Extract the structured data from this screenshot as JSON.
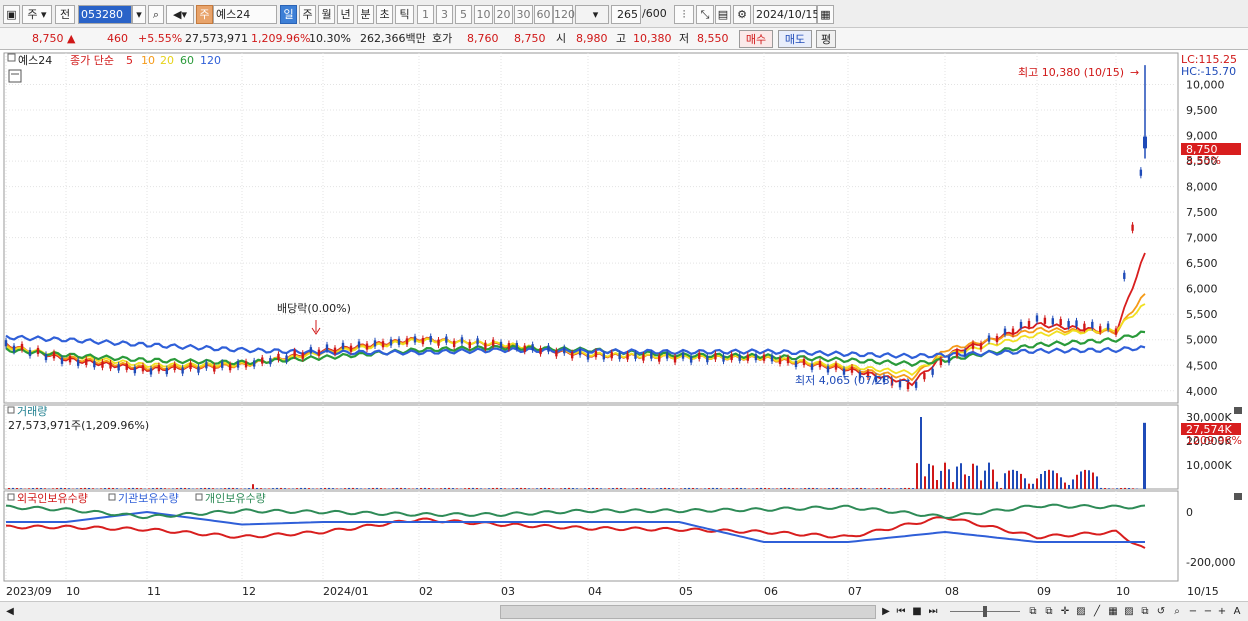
{
  "toolbar": {
    "market": "주",
    "prev_label": "전",
    "code": "053280",
    "stock_tag": "주",
    "stock_name": "예스24",
    "periods": [
      "일",
      "주",
      "월",
      "년",
      "분",
      "초",
      "틱"
    ],
    "selected_period": "일",
    "intervals": [
      "1",
      "3",
      "5",
      "10",
      "20",
      "30",
      "60",
      "120"
    ],
    "count": "265",
    "count_max": "/600",
    "date": "2024/10/15"
  },
  "info": {
    "price": "8,750",
    "change": "460",
    "change_pct": "+5.55%",
    "volume": "27,573,971",
    "volume_ratio": "1,209.96%",
    "turnover": "10.30%",
    "amount": "262,366백만",
    "quote_label": "호가",
    "ask": "8,760",
    "bid": "8,750",
    "open_label": "시",
    "open": "8,980",
    "high_label": "고",
    "high": "10,380",
    "low_label": "저",
    "low": "8,550",
    "buy_label": "매수",
    "sell_label": "매도",
    "avg_label": "평"
  },
  "colors": {
    "up": "#d01818",
    "down": "#1f4bb8",
    "ma5": "#d81e1e",
    "ma10": "#f59a18",
    "ma20": "#f0e020",
    "ma60": "#2a9a3a",
    "ma120": "#2f5fd8",
    "foreign": "#d81e1e",
    "inst": "#2f5fd8",
    "indiv": "#2e8b57"
  },
  "price_panel": {
    "legend_name": "예스24",
    "legend_text": "종가 단순",
    "ma_labels": [
      "5",
      "10",
      "20",
      "60",
      "120"
    ],
    "lc_label": "LC:115.25",
    "hc_label": "HC:-15.70",
    "current_price": "8,750",
    "current_pct": "5.55%",
    "high_annotation": "최고 10,380 (10/15)",
    "low_annotation": "최저 4,065 (07/23)",
    "dividend_annotation": "배당락(0.00%)"
  },
  "volume_panel": {
    "title": "거래량",
    "summary": "27,573,971주(1,209.96%)",
    "current_volume": "27,574K",
    "current_ratio": "1209.96%"
  },
  "holding_panel": {
    "series_labels": [
      "외국인보유수량",
      "기관보유수량",
      "개인보유수량"
    ]
  },
  "x_axis_labels": [
    "2023/09",
    "10",
    "11",
    "12",
    "2024/01",
    "02",
    "03",
    "04",
    "05",
    "06",
    "07",
    "08",
    "09",
    "10",
    "10/15"
  ],
  "chart_data": [
    {
      "type": "line",
      "title": "예스24",
      "x": [
        "2023/09",
        "2023/10",
        "2023/11",
        "2023/12",
        "2024/01",
        "2024/02",
        "2024/03",
        "2024/04",
        "2024/05",
        "2024/06",
        "2024/07",
        "2024/07/23",
        "2024/08",
        "2024/09",
        "2024/10",
        "2024/10/15"
      ],
      "series": [
        {
          "name": "종가",
          "values": [
            4900,
            4600,
            4400,
            4500,
            4800,
            5000,
            4900,
            4700,
            4650,
            4650,
            4400,
            4065,
            4600,
            5400,
            5200,
            8750
          ]
        },
        {
          "name": "5",
          "values": [
            4900,
            4620,
            4420,
            4500,
            4780,
            5020,
            4900,
            4700,
            4660,
            4640,
            4420,
            4150,
            4700,
            5300,
            5150,
            6700
          ]
        },
        {
          "name": "10",
          "values": [
            4880,
            4650,
            4450,
            4500,
            4760,
            5010,
            4910,
            4710,
            4660,
            4640,
            4440,
            4250,
            4800,
            5200,
            5150,
            5900
          ]
        },
        {
          "name": "20",
          "values": [
            4850,
            4700,
            4500,
            4520,
            4740,
            4990,
            4920,
            4720,
            4660,
            4650,
            4480,
            4350,
            4700,
            5100,
            5200,
            5700
          ]
        },
        {
          "name": "60",
          "values": [
            4800,
            4700,
            4600,
            4550,
            4650,
            4800,
            4850,
            4800,
            4700,
            4680,
            4600,
            4530,
            4600,
            4900,
            5000,
            5150
          ]
        },
        {
          "name": "120",
          "values": [
            5050,
            5000,
            4900,
            4800,
            4750,
            4750,
            4800,
            4780,
            4760,
            4770,
            4720,
            4680,
            4700,
            4780,
            4800,
            4850
          ]
        }
      ],
      "ohlc_last": {
        "open": 8980,
        "high": 10380,
        "low": 8550,
        "close": 8750
      },
      "annotations": [
        {
          "text": "최고 10,380 (10/15)",
          "x": "2024/10/15",
          "y": 10380
        },
        {
          "text": "최저 4,065 (07/23)",
          "x": "2024/07/23",
          "y": 4065
        },
        {
          "text": "배당락(0.00%)",
          "x": "2023/12/27",
          "y": 5000
        }
      ],
      "ylim": [
        3800,
        10500
      ],
      "yticks": [
        4000,
        4500,
        5000,
        5500,
        6000,
        6500,
        7000,
        7500,
        8000,
        8500,
        9000,
        9500,
        10000
      ],
      "ytick_labels": [
        "4,000",
        "4,500",
        "5,000",
        "5,500",
        "6,000",
        "6,500",
        "7,000",
        "7,500",
        "8,000",
        "8,500",
        "9,000",
        "9,500",
        "10,000"
      ],
      "grid": true
    },
    {
      "type": "bar",
      "title": "거래량",
      "x": [
        "2023/09",
        "2023/12",
        "2024/07",
        "2024/08",
        "2024/09",
        "2024/10",
        "2024/10/15"
      ],
      "values": [
        400,
        2000,
        1000,
        30000,
        9000,
        12000,
        27574
      ],
      "unit": "K",
      "ylim": [
        0,
        30000
      ],
      "yticks": [
        10000,
        20000,
        30000
      ],
      "ytick_labels": [
        "10,000K",
        "20,000K",
        "30,000K"
      ]
    },
    {
      "type": "line",
      "title": "보유수량",
      "x": [
        "2023/09",
        "2023/10",
        "2023/11",
        "2023/12",
        "2024/01",
        "2024/02",
        "2024/03",
        "2024/04",
        "2024/05",
        "2024/06",
        "2024/07",
        "2024/08",
        "2024/09",
        "2024/10",
        "2024/10/15"
      ],
      "series": [
        {
          "name": "외국인보유수량",
          "values": [
            -60000,
            -60000,
            -70000,
            -100000,
            -80000,
            -30000,
            -50000,
            -65000,
            -70000,
            -80000,
            -100000,
            -20000,
            -100000,
            -80000,
            -150000
          ]
        },
        {
          "name": "기관보유수량",
          "values": [
            -40000,
            -40000,
            0,
            -50000,
            -40000,
            -40000,
            -40000,
            -40000,
            -40000,
            -120000,
            -120000,
            -80000,
            -120000,
            -120000,
            -120000
          ]
        },
        {
          "name": "개인보유수량",
          "values": [
            20000,
            10000,
            -20000,
            5000,
            0,
            -10000,
            -10000,
            5000,
            5000,
            10000,
            20000,
            -20000,
            25000,
            20000,
            20000
          ]
        }
      ],
      "ylim": [
        -260000,
        60000
      ],
      "yticks": [
        0,
        -200000
      ],
      "ytick_labels": [
        "0",
        "-200,000"
      ]
    }
  ]
}
